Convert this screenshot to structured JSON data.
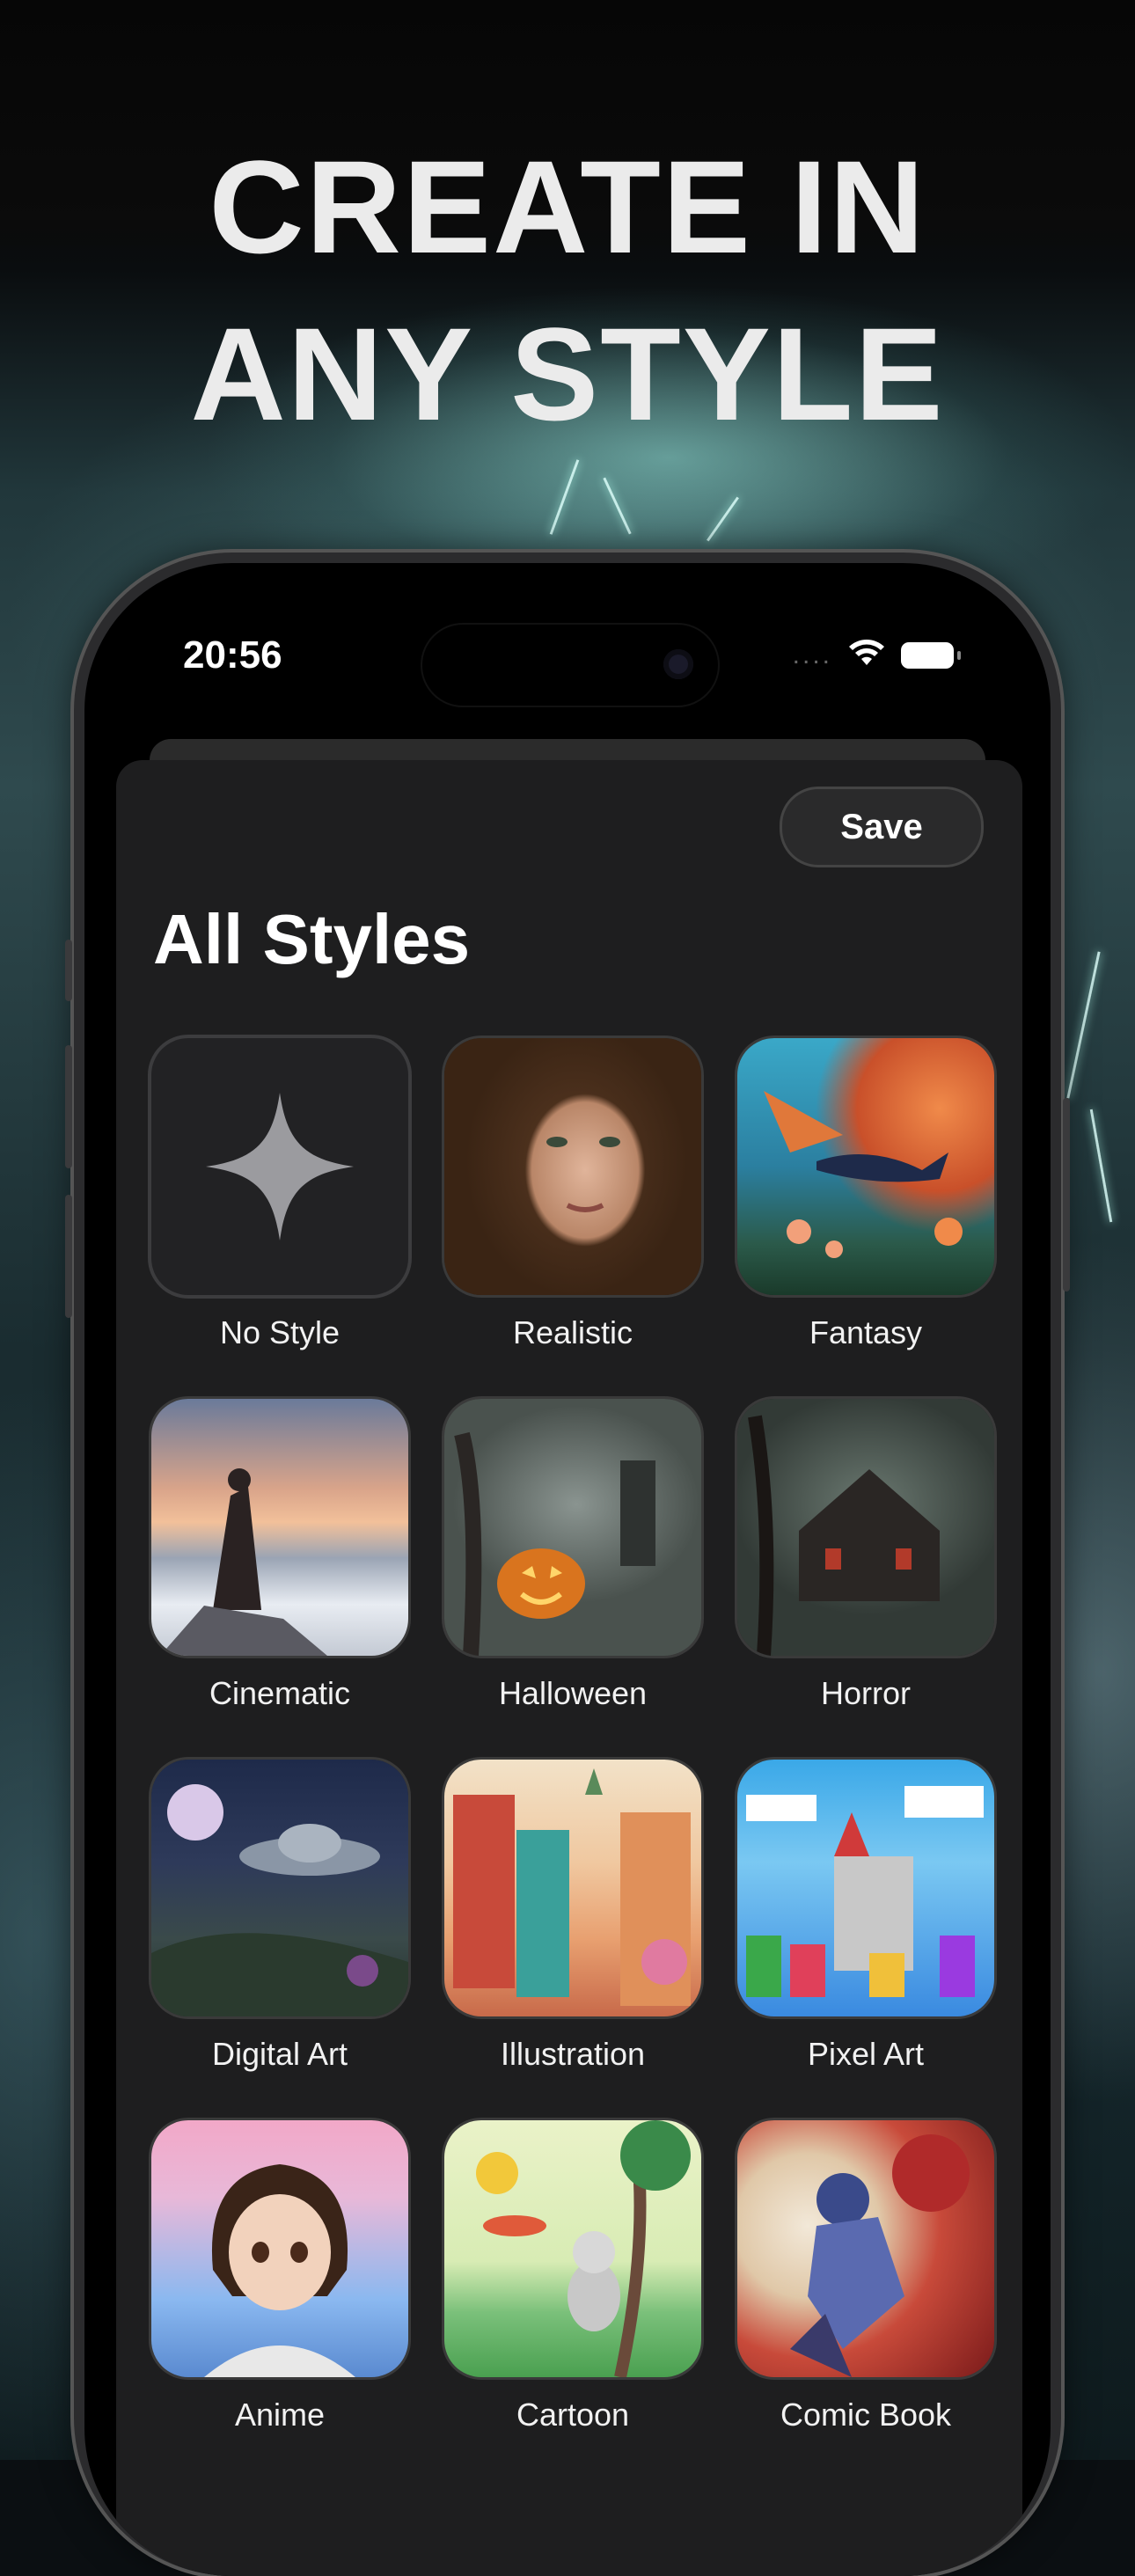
{
  "headline": {
    "line1": "CREATE IN",
    "line2": "ANY STYLE"
  },
  "status_bar": {
    "time": "20:56",
    "signal": "....",
    "wifi_icon": "wifi-icon",
    "battery_icon": "battery-icon"
  },
  "sheet": {
    "save_label": "Save",
    "title": "All Styles",
    "styles": [
      {
        "label": "No Style",
        "icon": "sparkle-icon"
      },
      {
        "label": "Realistic"
      },
      {
        "label": "Fantasy"
      },
      {
        "label": "Cinematic"
      },
      {
        "label": "Halloween"
      },
      {
        "label": "Horror"
      },
      {
        "label": "Digital Art"
      },
      {
        "label": "Illustration"
      },
      {
        "label": "Pixel Art"
      },
      {
        "label": "Anime"
      },
      {
        "label": "Cartoon"
      },
      {
        "label": "Comic Book"
      }
    ]
  },
  "colors": {
    "sheet_bg": "#1e1e1f",
    "accent_text": "#ffffff",
    "headline": "#ebebeb"
  }
}
